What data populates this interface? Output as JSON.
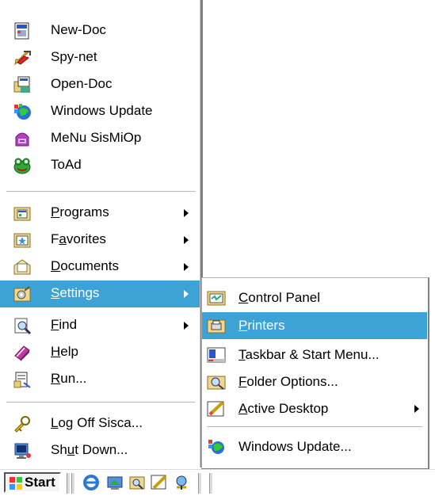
{
  "menu": {
    "pinned": [
      {
        "label": "New-Doc",
        "icon": "new-doc-icon"
      },
      {
        "label": "Spy-net",
        "icon": "spy-net-icon"
      },
      {
        "label": "Open-Doc",
        "icon": "open-doc-icon"
      },
      {
        "label": "Windows Update",
        "icon": "windows-update-icon"
      },
      {
        "label": "MeNu SisMiOp",
        "icon": "menu-sismiop-icon"
      },
      {
        "label": "ToAd",
        "icon": "frog-icon"
      }
    ],
    "main": [
      {
        "pre": "",
        "key": "P",
        "post": "rograms",
        "icon": "programs-icon",
        "submenu": true
      },
      {
        "pre": "F",
        "key": "a",
        "post": "vorites",
        "icon": "favorites-icon",
        "submenu": true
      },
      {
        "pre": "",
        "key": "D",
        "post": "ocuments",
        "icon": "documents-icon",
        "submenu": true
      },
      {
        "pre": "",
        "key": "S",
        "post": "ettings",
        "icon": "settings-icon",
        "submenu": true,
        "highlighted": true
      },
      {
        "pre": "",
        "key": "F",
        "post": "ind",
        "icon": "find-icon",
        "submenu": true
      },
      {
        "pre": "",
        "key": "H",
        "post": "elp",
        "icon": "help-icon",
        "submenu": false
      },
      {
        "pre": "",
        "key": "R",
        "post": "un...",
        "icon": "run-icon",
        "submenu": false
      }
    ],
    "session": [
      {
        "pre": "",
        "key": "L",
        "post": "og Off Sisca...",
        "icon": "log-off-icon"
      },
      {
        "pre": "Sh",
        "key": "u",
        "post": "t Down...",
        "icon": "shut-down-icon"
      }
    ]
  },
  "settings_submenu": [
    {
      "pre": "",
      "key": "C",
      "post": "ontrol Panel",
      "icon": "control-panel-icon"
    },
    {
      "pre": "",
      "key": "P",
      "post": "rinters",
      "icon": "printers-folder-icon",
      "highlighted": true
    },
    {
      "pre": "",
      "key": "T",
      "post": "askbar & Start Menu...",
      "icon": "taskbar-icon"
    },
    {
      "pre": "",
      "key": "F",
      "post": "older Options...",
      "icon": "folder-options-icon"
    },
    {
      "pre": "",
      "key": "A",
      "post": "ctive Desktop",
      "icon": "active-desktop-icon",
      "submenu": true
    },
    {
      "pre": "",
      "key": "",
      "post": "Windows Update...",
      "icon": "windows-update-icon"
    }
  ],
  "taskbar": {
    "start_label": "Start",
    "quick_launch": [
      "internet-explorer-icon",
      "desktop-icon",
      "explorer-icon",
      "edit-icon",
      "media-icon"
    ]
  },
  "colors": {
    "highlight": "#3da2d6"
  }
}
